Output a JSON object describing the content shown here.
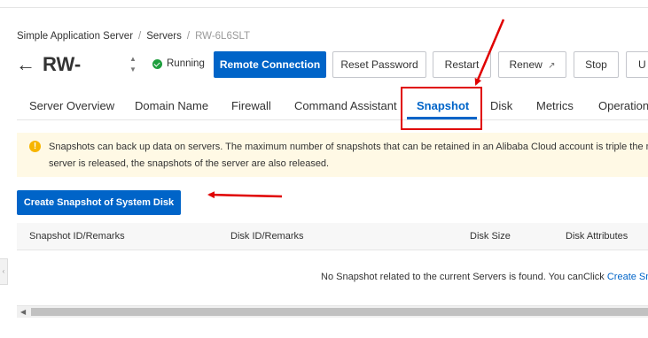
{
  "breadcrumb": {
    "items": [
      "Simple Application Server",
      "Servers",
      "RW-6L6SLT"
    ]
  },
  "header": {
    "title": "RW-",
    "status": "Running"
  },
  "actions": {
    "remote_connection": "Remote Connection",
    "reset_password": "Reset Password",
    "restart": "Restart",
    "renew": "Renew",
    "stop": "Stop",
    "more": "U"
  },
  "tabs": [
    {
      "label": "Server Overview"
    },
    {
      "label": "Domain Name"
    },
    {
      "label": "Firewall"
    },
    {
      "label": "Command Assistant"
    },
    {
      "label": "Snapshot",
      "active": true
    },
    {
      "label": "Disk"
    },
    {
      "label": "Metrics"
    },
    {
      "label": "Operation"
    }
  ],
  "notice": {
    "line1": "Snapshots can back up data on servers. The maximum number of snapshots that can be retained in an Alibaba Cloud account is triple the num",
    "line2": "server is released, the snapshots of the server are also released."
  },
  "create_button": "Create Snapshot of System Disk",
  "table": {
    "columns": [
      "Snapshot ID/Remarks",
      "Disk ID/Remarks",
      "Disk Size",
      "Disk Attributes"
    ],
    "empty_text": "No Snapshot related to the current Servers is found. You canClick ",
    "empty_link": "Create Snap"
  },
  "colors": {
    "accent": "#0064c8",
    "annotation": "#e00000",
    "running": "#1e9e3e",
    "notice_bg": "#fff9e5"
  }
}
